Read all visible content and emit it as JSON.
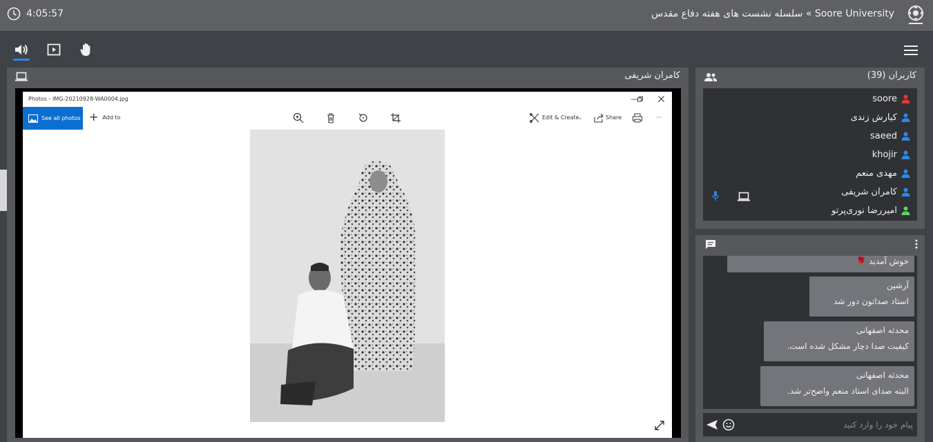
{
  "topbar": {
    "timer": "4:05:57",
    "title": "Soore University » سلسله نشست های هفته دفاع مقدس",
    "logo_icon": "university-seal-icon"
  },
  "toolbar": {
    "audio_icon": "speaker-icon",
    "share_icon": "presentation-icon",
    "raise_hand_icon": "hand-icon",
    "menu_icon": "hamburger-menu-icon",
    "accent": "#2b8ae6"
  },
  "presenter": {
    "name": "کامران شریفی",
    "photos_app": {
      "title": "Photos - IMG-20210928-WA0004.jpg",
      "see_all": "See all photos",
      "add_to": "Add to",
      "edit_create": "Edit & Create",
      "share": "Share",
      "more": "···"
    }
  },
  "users": {
    "header": "کاربران (39)",
    "list": [
      {
        "name": "soore",
        "color": "#e53935"
      },
      {
        "name": "کیارش زندی",
        "color": "#2b8ae6"
      },
      {
        "name": "saeed",
        "color": "#2b8ae6"
      },
      {
        "name": "khojir",
        "color": "#2b8ae6"
      },
      {
        "name": "مهدی منعم",
        "color": "#2b8ae6"
      },
      {
        "name": "کامران شریفی",
        "color": "#2b8ae6"
      },
      {
        "name": "امیررضا نوری‌پرتو",
        "color": "#5fd35f"
      }
    ]
  },
  "chat": {
    "messages": [
      {
        "name": "",
        "text": "خوش آمدید 🌹"
      },
      {
        "name": "آرشین",
        "text": "استاد صداتون دور شد"
      },
      {
        "name": "محدثه اصفهانی",
        "text": "کیفیت صدا دچار مشکل شده است."
      },
      {
        "name": "محدثه اصفهانی",
        "text": "البته صدای استاد منعم واضح‌تر شد."
      }
    ],
    "placeholder": "پیام خود را وارد کنید"
  }
}
